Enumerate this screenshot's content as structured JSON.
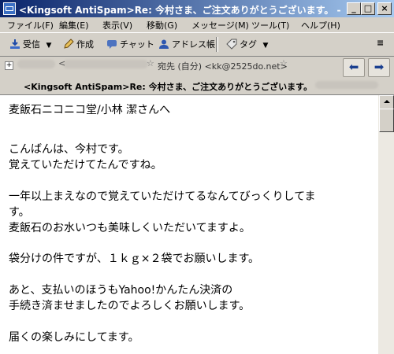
{
  "window": {
    "title": "<Kingsoft AntiSpam>Re: 今村さま、ご注文ありがとうございます。 - Mozilla Th",
    "minimize": "_",
    "maximize": "□",
    "close": "×"
  },
  "menu": [
    "ファイル(F)",
    "編集(E)",
    "表示(V)",
    "移動(G)",
    "メッセージ(M)",
    "ツール(T)",
    "ヘルプ(H)"
  ],
  "toolbar": {
    "receive": "受信",
    "compose": "作成",
    "chat": "チャット",
    "address_book": "アドレス帳",
    "tag": "タグ"
  },
  "header": {
    "to": "宛先 (自分) <kk@2525do.net>",
    "subject": "<Kingsoft AntiSpam>Re: 今村さま、ご注文ありがとうございます。"
  },
  "body": {
    "lines": [
      "麦飯石ニコニコ堂/小林 潔さんへ",
      "",
      "",
      "こんばんは、今村です。",
      "覚えていただけてたんですね。",
      "",
      "一年以上まえなので覚えていただけてるなんてびっくりしてま",
      "す。",
      "麦飯石のお水いつも美味しくいただいてますよ。",
      "",
      "袋分けの件ですが、１ｋｇ×２袋でお願いします。",
      "",
      "あと、支払いのほうもYahoo!かんたん決済の",
      "手続き済ませましたのでよろしくお願いします。",
      "",
      "届くの楽しみにしてます。"
    ]
  },
  "colors": {
    "titlebar_start": "#0a246a",
    "titlebar_end": "#a6caf0",
    "chrome": "#d4d0c8"
  }
}
